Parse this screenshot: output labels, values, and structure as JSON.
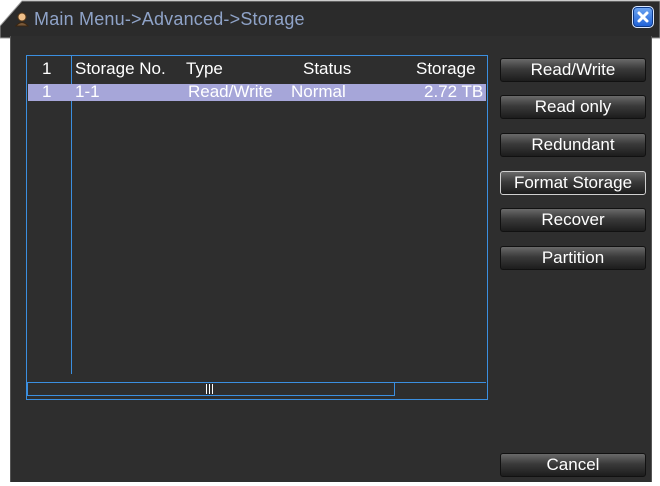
{
  "window": {
    "title": "Main Menu->Advanced->Storage",
    "close_icon": "close-icon",
    "title_icon": "user-icon"
  },
  "table": {
    "headers": {
      "index": "1",
      "storage_no": "Storage No.",
      "type": "Type",
      "status": "Status",
      "storage": "Storage"
    },
    "rows": [
      {
        "index": "1",
        "storage_no": "1-1",
        "type": "Read/Write",
        "status": "Normal",
        "storage": "2.72 TB"
      }
    ],
    "selected_row_color": "#a6a6d9",
    "border_color": "#3b8fe0"
  },
  "buttons": {
    "read_write": "Read/Write",
    "read_only": "Read only",
    "redundant": "Redundant",
    "format_storage": "Format Storage",
    "recover": "Recover",
    "partition": "Partition",
    "cancel": "Cancel"
  }
}
